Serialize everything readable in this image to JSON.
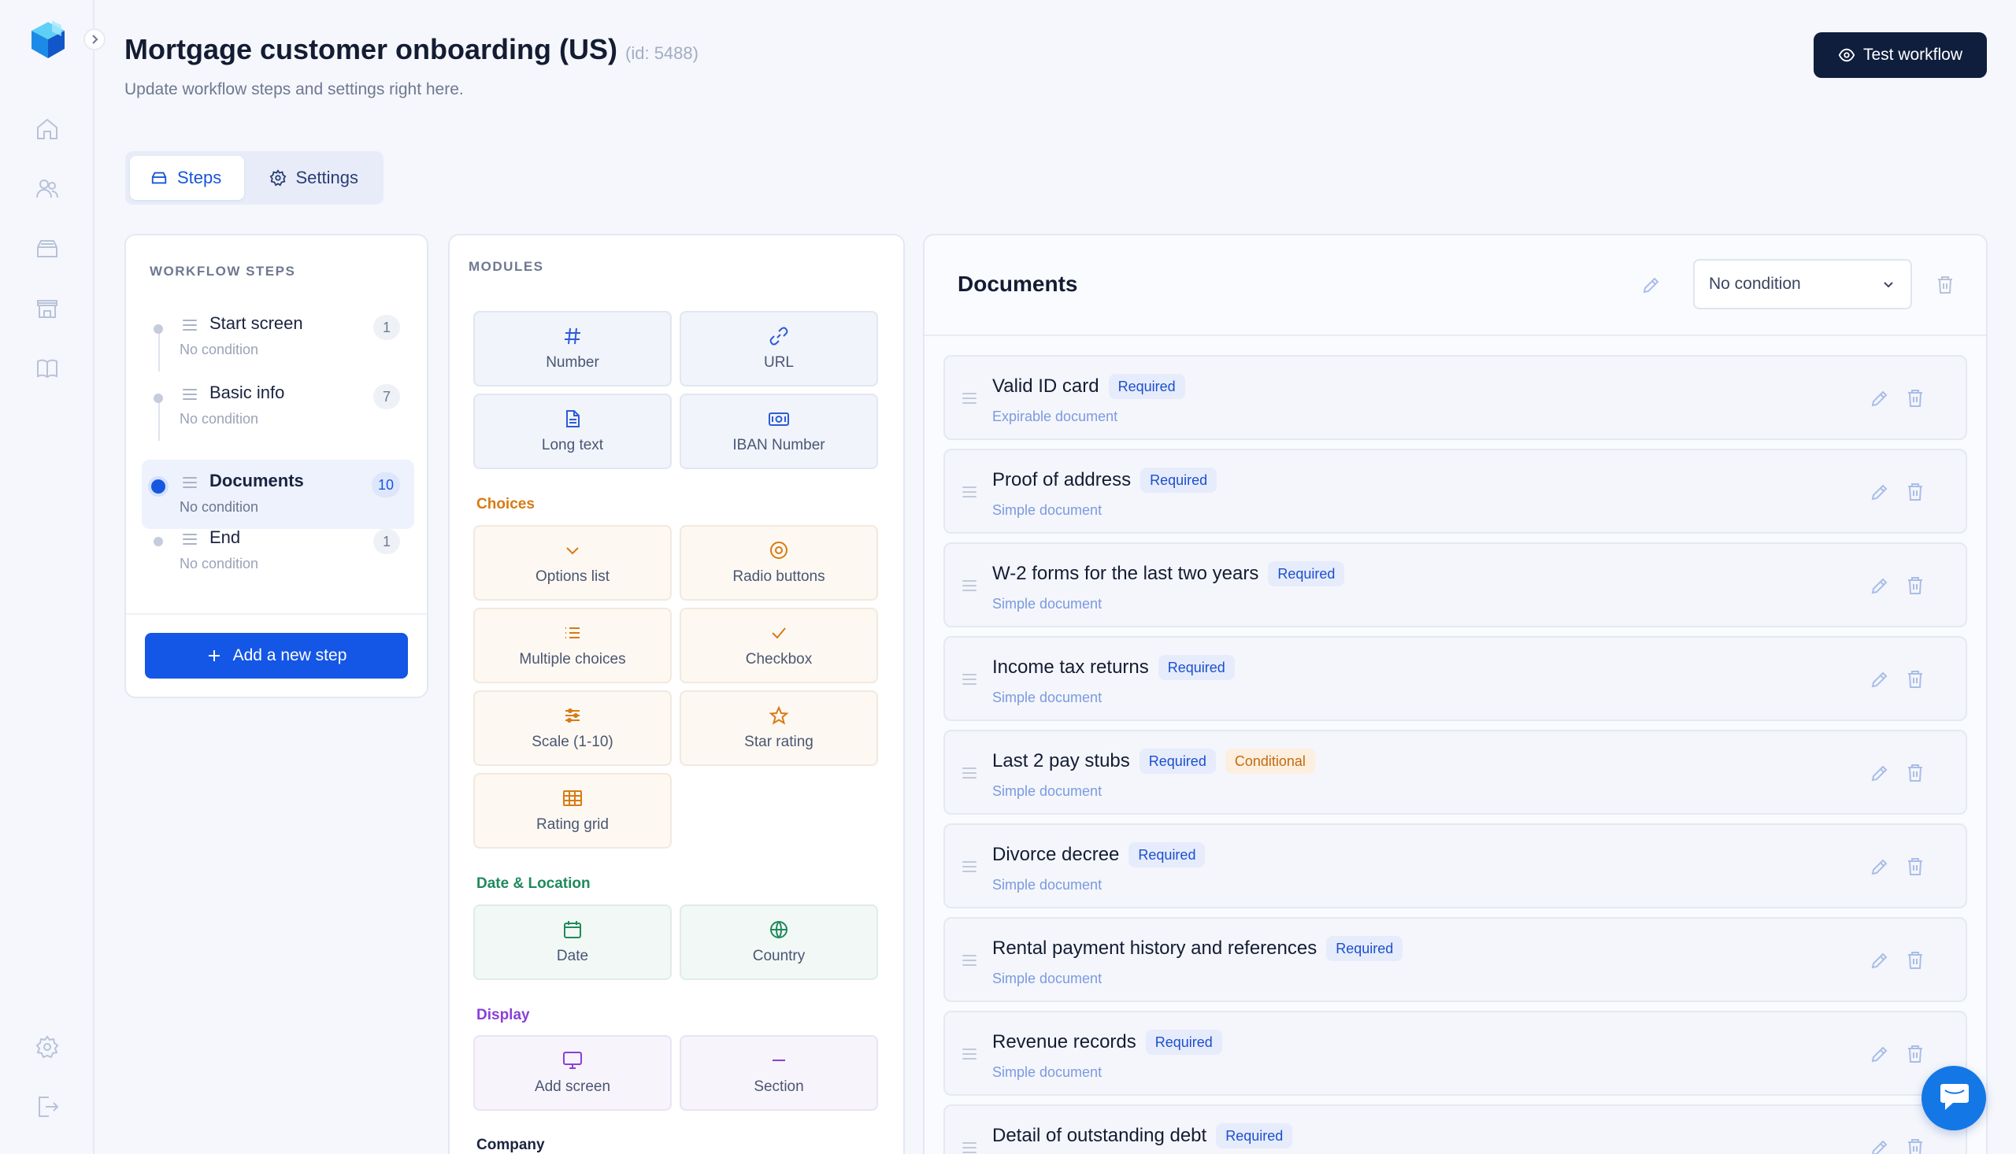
{
  "header": {
    "title": "Mortgage customer onboarding (US)",
    "id_label": "(id: 5488)",
    "subtitle": "Update workflow steps and settings right here.",
    "test_button": "Test workflow"
  },
  "tabs": [
    {
      "label": "Steps",
      "icon": "drawer-icon",
      "active": true
    },
    {
      "label": "Settings",
      "icon": "gear-icon",
      "active": false
    }
  ],
  "workflow": {
    "label": "WORKFLOW STEPS",
    "steps": [
      {
        "name": "Start screen",
        "condition": "No condition",
        "count": "1",
        "active": false
      },
      {
        "name": "Basic info",
        "condition": "No condition",
        "count": "7",
        "active": false
      },
      {
        "name": "Documents",
        "condition": "No condition",
        "count": "10",
        "active": true
      },
      {
        "name": "End",
        "condition": "No condition",
        "count": "1",
        "active": false
      }
    ],
    "add_button": "Add a new step"
  },
  "modules": {
    "label": "MODULES",
    "basic": [
      {
        "label": "Number",
        "icon": "hash-icon"
      },
      {
        "label": "URL",
        "icon": "link-icon"
      },
      {
        "label": "Long text",
        "icon": "document-icon"
      },
      {
        "label": "IBAN Number",
        "icon": "banknote-icon"
      }
    ],
    "choices_title": "Choices",
    "choices": [
      {
        "label": "Options list",
        "icon": "chevron-down-icon"
      },
      {
        "label": "Radio buttons",
        "icon": "radio-icon"
      },
      {
        "label": "Multiple choices",
        "icon": "list-icon"
      },
      {
        "label": "Checkbox",
        "icon": "check-icon"
      },
      {
        "label": "Scale (1-10)",
        "icon": "sliders-icon"
      },
      {
        "label": "Star rating",
        "icon": "star-icon"
      },
      {
        "label": "Rating grid",
        "icon": "grid-icon"
      }
    ],
    "date_title": "Date & Location",
    "date": [
      {
        "label": "Date",
        "icon": "calendar-icon"
      },
      {
        "label": "Country",
        "icon": "globe-icon"
      }
    ],
    "display_title": "Display",
    "display": [
      {
        "label": "Add screen",
        "icon": "monitor-icon"
      },
      {
        "label": "Section",
        "icon": "minus-icon"
      }
    ],
    "company_title": "Company"
  },
  "documents": {
    "title": "Documents",
    "condition_select": "No condition",
    "items": [
      {
        "name": "Valid ID card",
        "badges": [
          "Required"
        ],
        "type": "Expirable document"
      },
      {
        "name": "Proof of address",
        "badges": [
          "Required"
        ],
        "type": "Simple document"
      },
      {
        "name": "W-2 forms for the last two years",
        "badges": [
          "Required"
        ],
        "type": "Simple document"
      },
      {
        "name": "Income tax returns",
        "badges": [
          "Required"
        ],
        "type": "Simple document"
      },
      {
        "name": "Last 2 pay stubs",
        "badges": [
          "Required",
          "Conditional"
        ],
        "type": "Simple document"
      },
      {
        "name": "Divorce decree",
        "badges": [
          "Required"
        ],
        "type": "Simple document"
      },
      {
        "name": "Rental payment history and references",
        "badges": [
          "Required"
        ],
        "type": "Simple document"
      },
      {
        "name": "Revenue records",
        "badges": [
          "Required"
        ],
        "type": "Simple document"
      },
      {
        "name": "Detail of outstanding debt",
        "badges": [
          "Required"
        ],
        "type": ""
      }
    ]
  },
  "colors": {
    "primary": "#1456e6",
    "dark_button": "#0f1e3d",
    "choices_accent": "#d97a12",
    "date_accent": "#1f8a5b",
    "display_accent": "#8a3fd8"
  }
}
